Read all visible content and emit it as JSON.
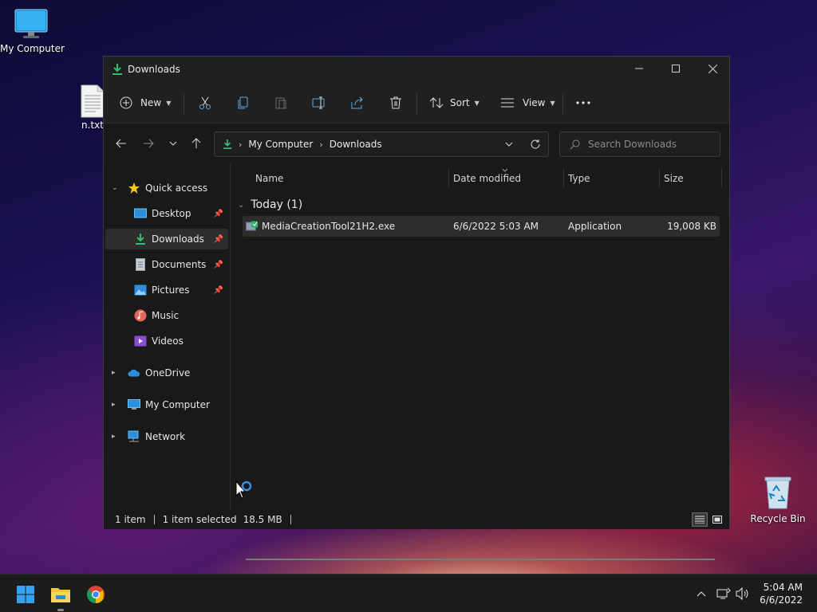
{
  "desktop": {
    "my_computer_label": "My Computer",
    "txt_file_label": "n.txt",
    "recycle_bin_label": "Recycle Bin"
  },
  "window": {
    "title": "Downloads",
    "title_icon": "download-arrow-icon"
  },
  "toolbar": {
    "new_label": "New",
    "sort_label": "Sort",
    "view_label": "View",
    "icons": [
      "plus-circle-icon",
      "cut-icon",
      "copy-icon",
      "paste-icon",
      "rename-icon",
      "share-icon",
      "delete-icon",
      "more-icon"
    ]
  },
  "address": {
    "crumbs": [
      "My Computer",
      "Downloads"
    ]
  },
  "search": {
    "placeholder": "Search Downloads"
  },
  "nav": {
    "quick_access": "Quick access",
    "items": [
      {
        "label": "Desktop",
        "icon": "desktop-icon",
        "pinned": true
      },
      {
        "label": "Downloads",
        "icon": "downloads-icon",
        "pinned": true,
        "selected": true
      },
      {
        "label": "Documents",
        "icon": "documents-icon",
        "pinned": true
      },
      {
        "label": "Pictures",
        "icon": "pictures-icon",
        "pinned": true
      },
      {
        "label": "Music",
        "icon": "music-icon",
        "pinned": false
      },
      {
        "label": "Videos",
        "icon": "videos-icon",
        "pinned": false
      }
    ],
    "onedrive": "OneDrive",
    "my_computer": "My Computer",
    "network": "Network"
  },
  "columns": {
    "name": "Name",
    "date": "Date modified",
    "type": "Type",
    "size": "Size"
  },
  "group": {
    "label": "Today (1)"
  },
  "files": [
    {
      "name": "MediaCreationTool21H2.exe",
      "date": "6/6/2022 5:03 AM",
      "type": "Application",
      "size": "19,008 KB"
    }
  ],
  "status": {
    "count": "1 item",
    "selected": "1 item selected",
    "size": "18.5 MB"
  },
  "taskbar": {
    "apps": [
      "windows-start-icon",
      "file-explorer-icon",
      "chrome-icon"
    ],
    "time": "5:04 AM",
    "date": "6/6/2022"
  },
  "colors": {
    "accent": "#0078d4",
    "window_bg": "#191919",
    "toolbar_bg": "#202020",
    "selection": "#2d2d2d",
    "taskbar_bg": "#1c1c1c"
  }
}
